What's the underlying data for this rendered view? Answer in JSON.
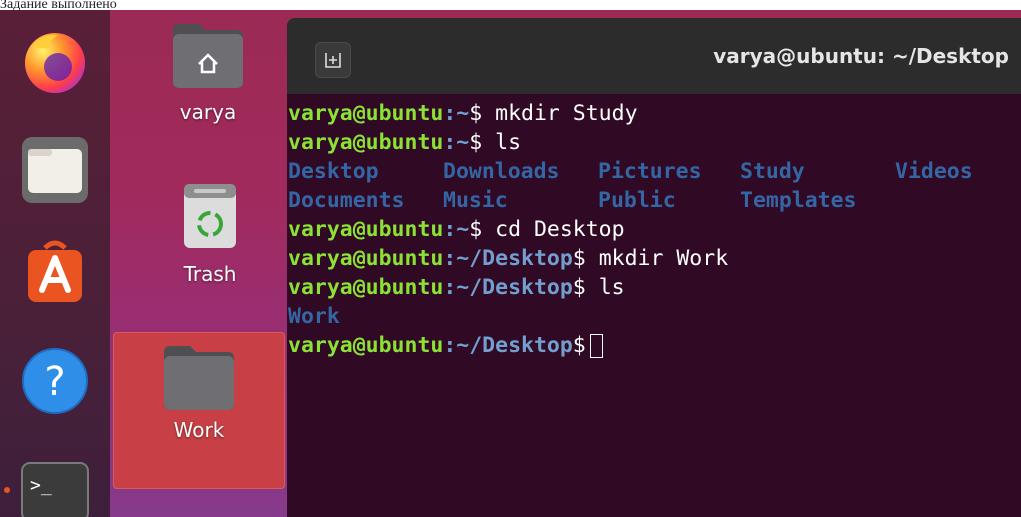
{
  "caption": "Задание выполнено",
  "colors": {
    "prompt_user": "#8ae234",
    "prompt_path": "#729fcf",
    "directory": "#3465a4",
    "terminal_bg": "#300a24",
    "selection": "#c84046"
  },
  "dock": {
    "items": [
      {
        "name": "Firefox",
        "icon": "firefox-icon"
      },
      {
        "name": "Files",
        "icon": "files-icon"
      },
      {
        "name": "Ubuntu Software",
        "icon": "appstore-icon"
      },
      {
        "name": "Help",
        "icon": "help-icon"
      },
      {
        "name": "Terminal",
        "icon": "terminal-icon"
      }
    ]
  },
  "desktop": {
    "home_label": "varya",
    "trash_label": "Trash",
    "work_label": "Work"
  },
  "terminal": {
    "title": "varya@ubuntu: ~/Desktop",
    "newtab_icon": "new-tab-icon",
    "user_host": "varya@ubuntu",
    "lines": [
      {
        "path": ":~",
        "cmd": " mkdir Study"
      },
      {
        "path": ":~",
        "cmd": " ls"
      },
      {
        "path": ":~",
        "cmd": " cd Desktop"
      },
      {
        "path": ":~/Desktop",
        "cmd": " mkdir Work"
      },
      {
        "path": ":~/Desktop",
        "cmd": " ls"
      },
      {
        "path": ":~/Desktop",
        "cmd": " "
      }
    ],
    "ls_home": [
      "Desktop",
      "Downloads",
      "Pictures",
      "Study",
      "Videos",
      "Documents",
      "Music",
      "Public",
      "Templates",
      ""
    ],
    "ls_desktop": [
      "Work"
    ],
    "dollar": "$"
  }
}
